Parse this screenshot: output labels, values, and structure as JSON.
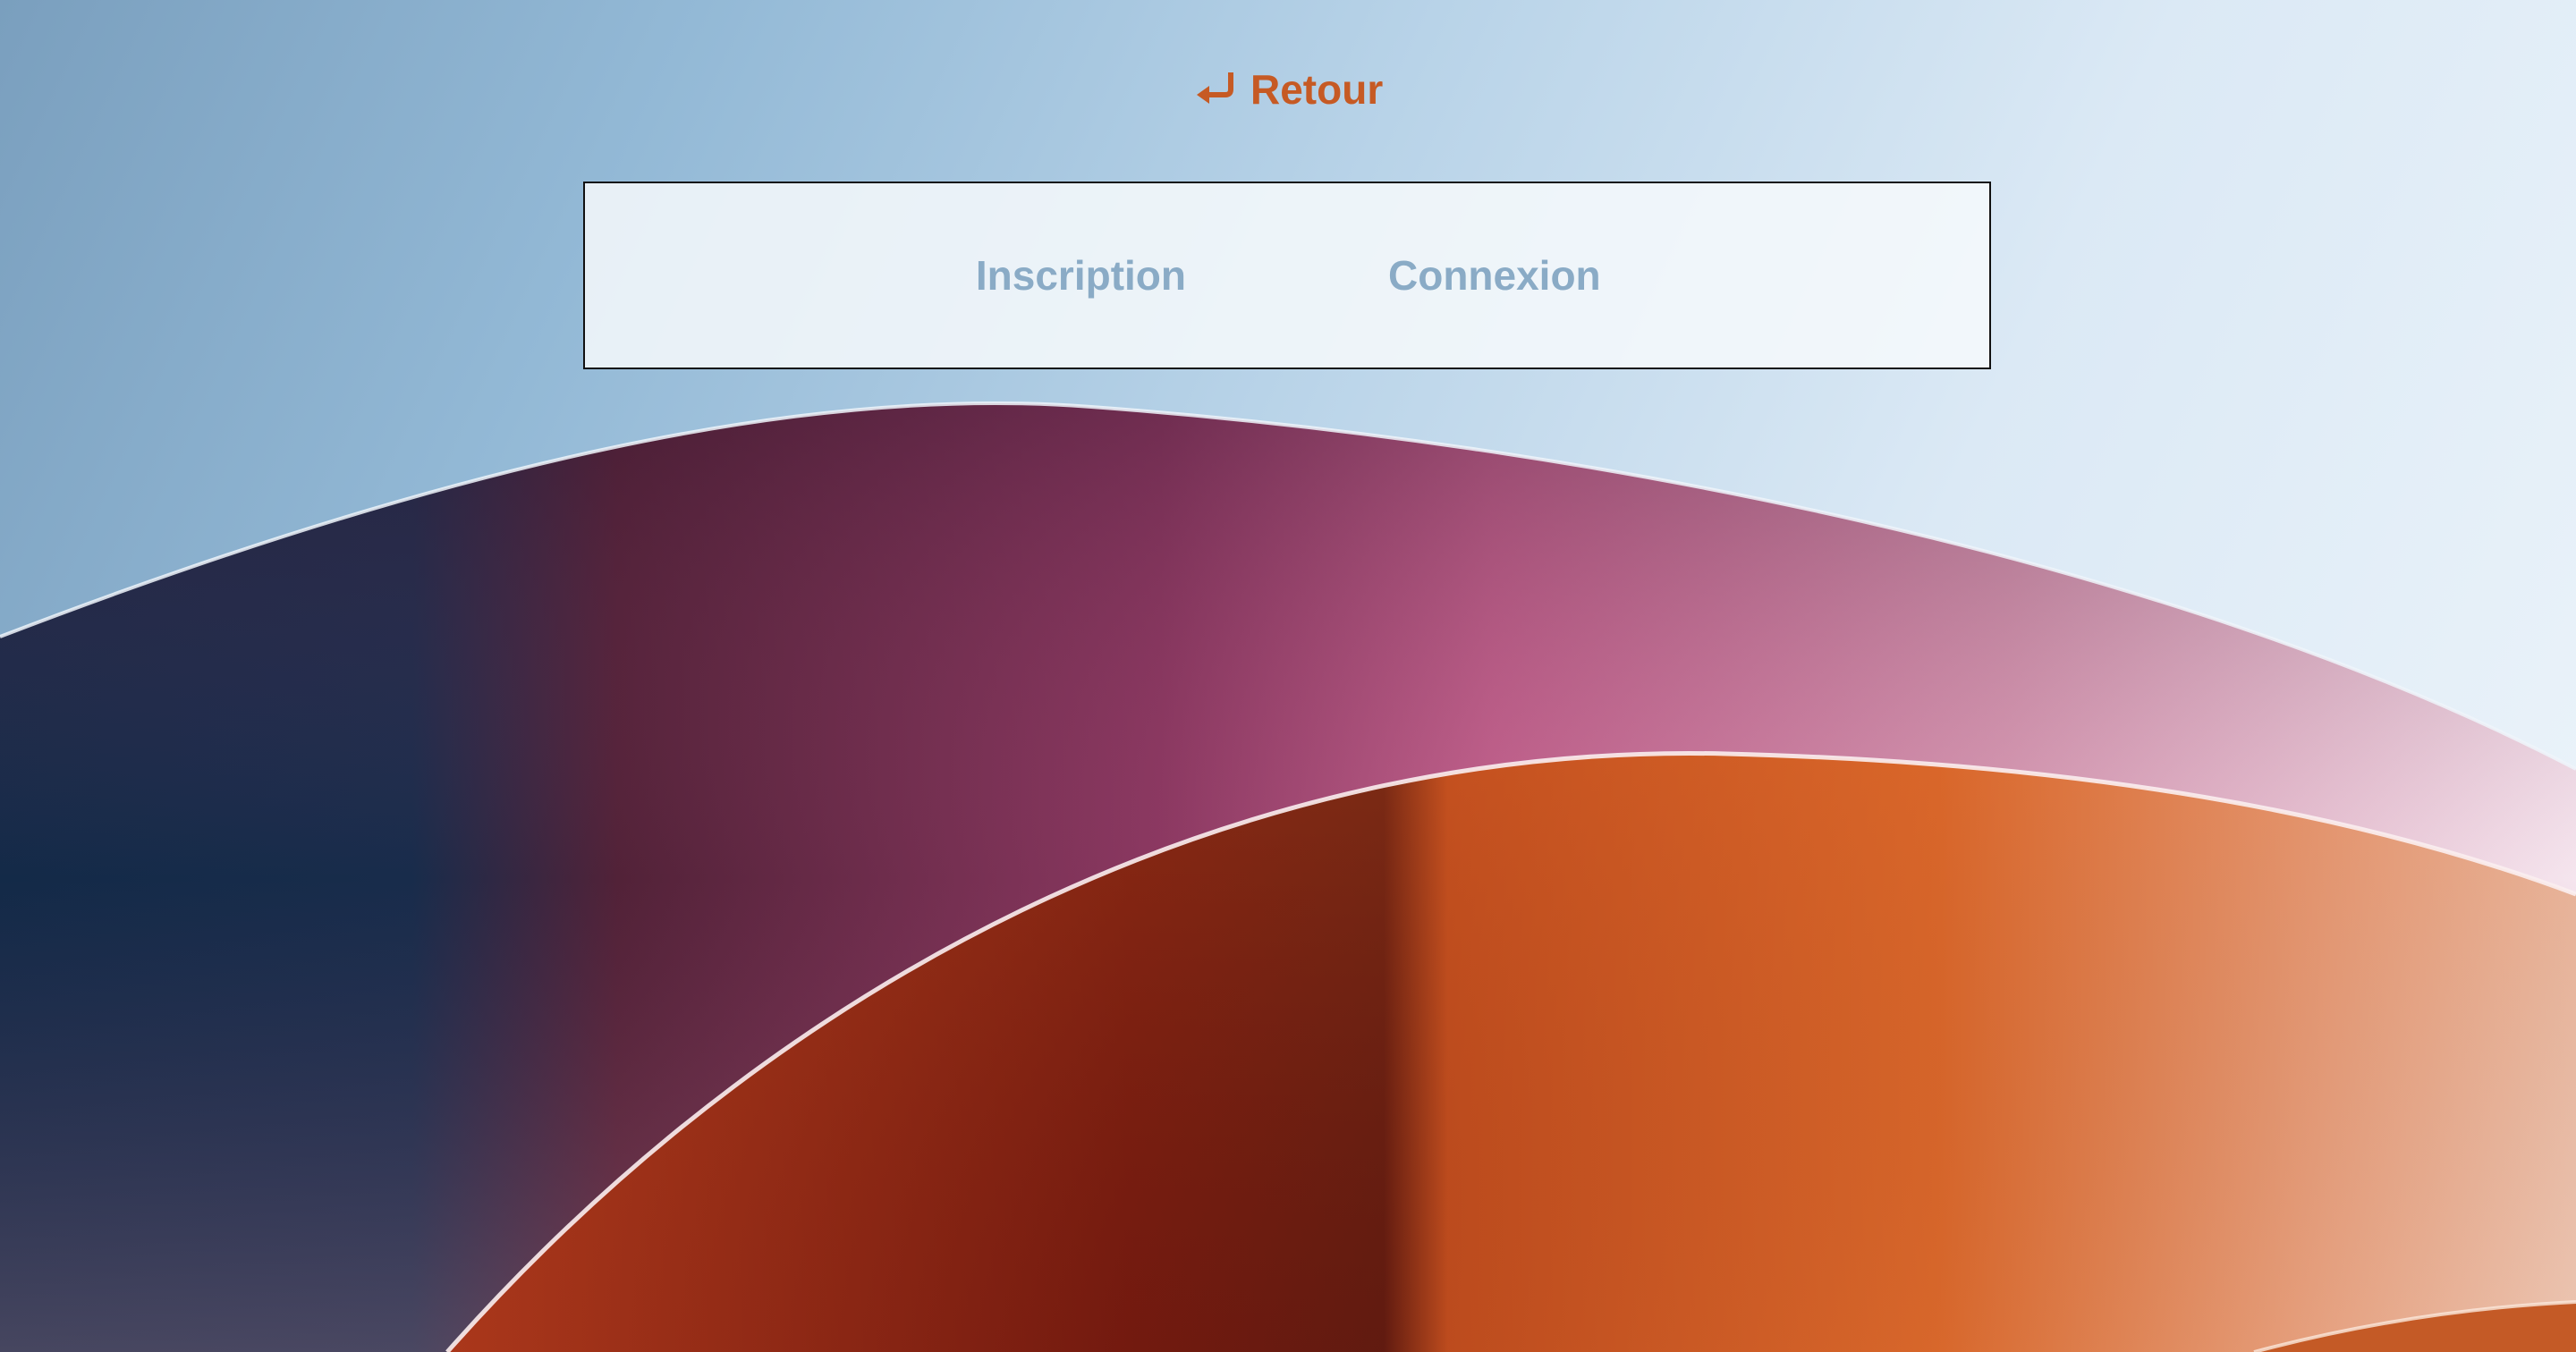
{
  "navigation": {
    "back_label": "Retour",
    "back_icon": "return-arrow-icon"
  },
  "tabs": [
    {
      "label": "Inscription"
    },
    {
      "label": "Connexion"
    }
  ],
  "colors": {
    "accent": "#c65a24",
    "tab_text": "#8aabc6",
    "panel_border": "#111111",
    "panel_background": "#f6f9fc"
  }
}
